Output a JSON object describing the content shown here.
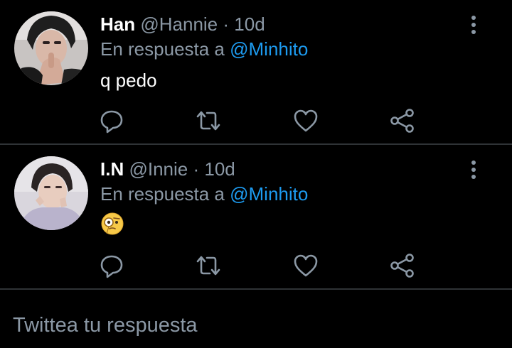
{
  "tweets": [
    {
      "name": "Han",
      "handle": "@Hannie",
      "separator": "·",
      "time": "10d",
      "reply_prefix": "En respuesta a",
      "reply_to": "@Minhito",
      "text": "q pedo",
      "avatar_icon": "avatar-photo"
    },
    {
      "name": "I.N",
      "handle": "@Innie",
      "separator": "·",
      "time": "10d",
      "reply_prefix": "En respuesta a",
      "reply_to": "@Minhito",
      "text": "🧐",
      "avatar_icon": "avatar-photo"
    }
  ],
  "actions": {
    "reply_icon": "reply-icon",
    "retweet_icon": "retweet-icon",
    "like_icon": "heart-icon",
    "share_icon": "share-icon",
    "more_icon": "more-vertical-icon"
  },
  "composer": {
    "placeholder": "Twittea tu respuesta"
  },
  "colors": {
    "background": "#000000",
    "text_primary": "#ffffff",
    "text_secondary": "#8b98a5",
    "accent": "#1d9bf0",
    "divider": "#2f3336"
  }
}
